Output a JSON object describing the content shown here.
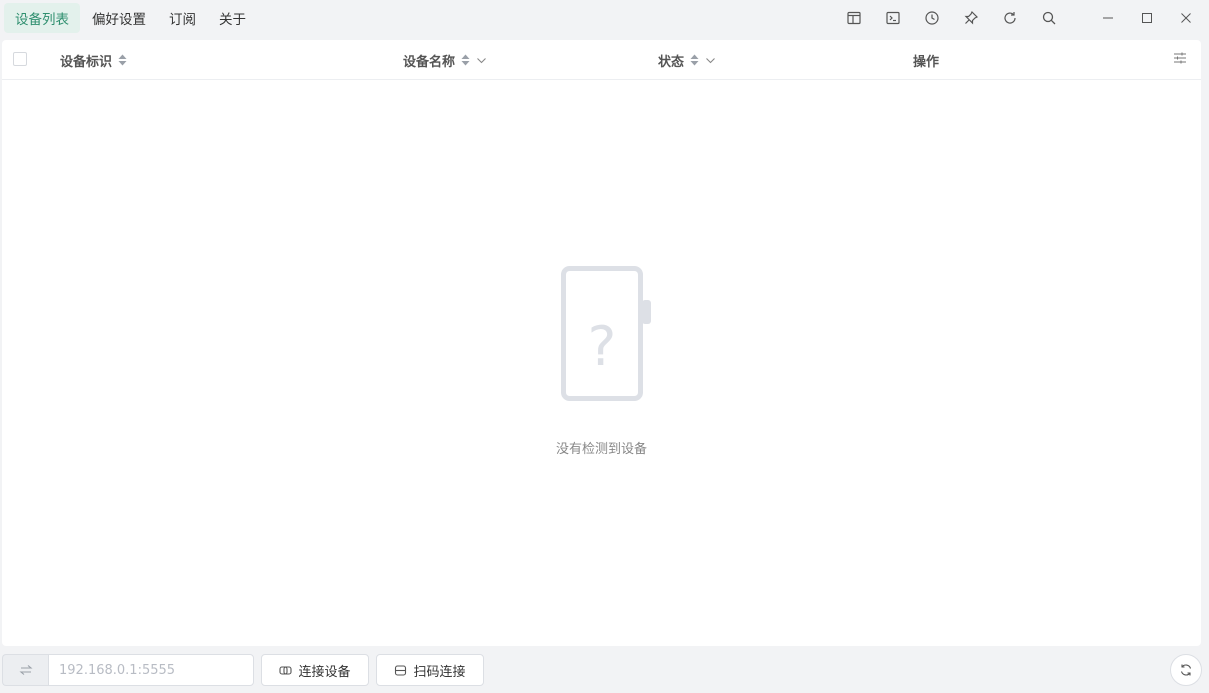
{
  "menu": {
    "items": [
      {
        "label": "设备列表",
        "active": true
      },
      {
        "label": "偏好设置",
        "active": false
      },
      {
        "label": "订阅",
        "active": false
      },
      {
        "label": "关于",
        "active": false
      }
    ]
  },
  "toolbar": {
    "icons": [
      "layout-icon",
      "terminal-icon",
      "history-icon",
      "pin-icon",
      "refresh-icon",
      "search-icon"
    ]
  },
  "window_controls": [
    "minimize-icon",
    "maximize-icon",
    "close-icon"
  ],
  "table": {
    "columns": {
      "device_id": "设备标识",
      "device_name": "设备名称",
      "status": "状态",
      "actions": "操作"
    },
    "rows": []
  },
  "empty_state": {
    "icon": "phone-question-icon",
    "text": "没有检测到设备"
  },
  "bottom": {
    "ip_placeholder": "192.168.0.1:5555",
    "connect_label": "连接设备",
    "scan_label": "扫码连接"
  },
  "colors": {
    "accent": "#2f8f6f",
    "accent_bg": "#e3f1ec",
    "illustration": "#dde0e6"
  }
}
